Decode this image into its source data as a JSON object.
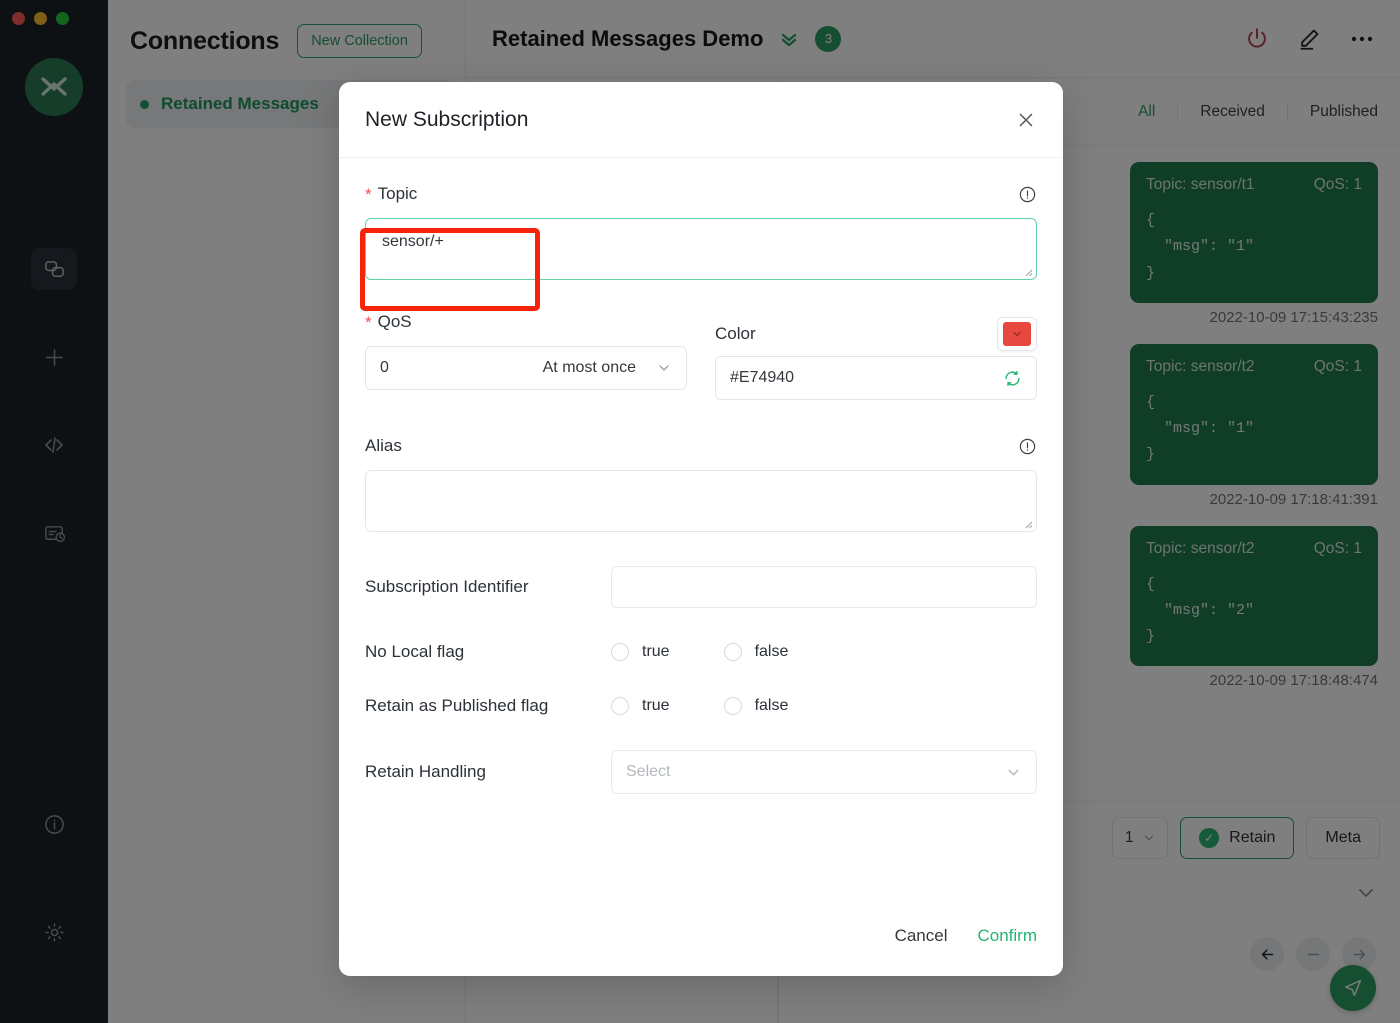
{
  "window": {
    "traffic_lights": [
      "close",
      "minimize",
      "maximize"
    ]
  },
  "rail": {
    "logo_alt": "mqttx-logo",
    "items": [
      {
        "name": "connections",
        "icon": "connections-icon",
        "active": true
      },
      {
        "name": "new-connection",
        "icon": "plus-icon",
        "active": false
      },
      {
        "name": "scripts",
        "icon": "code-icon",
        "active": false
      },
      {
        "name": "log",
        "icon": "log-icon",
        "active": false
      }
    ],
    "bottom_items": [
      {
        "name": "about",
        "icon": "info-icon"
      },
      {
        "name": "settings",
        "icon": "gear-icon"
      }
    ]
  },
  "connections": {
    "title": "Connections",
    "new_collection_label": "New Collection",
    "items": [
      {
        "name": "Retained Messages",
        "status": "connected"
      }
    ]
  },
  "main": {
    "title": "Retained Messages Demo",
    "chevron_icon": "chevron-double-down-icon",
    "badge_count": "3",
    "actions": [
      {
        "name": "disconnect",
        "icon": "power-icon",
        "color": "#b5464a"
      },
      {
        "name": "edit",
        "icon": "pencil-icon",
        "color": "#22272c"
      },
      {
        "name": "more",
        "icon": "ellipsis-icon",
        "color": "#22272c"
      }
    ],
    "message_tabs": [
      {
        "label": "All",
        "active": true
      },
      {
        "label": "Received",
        "active": false
      },
      {
        "label": "Published",
        "active": false
      }
    ],
    "messages": [
      {
        "topic_label": "Topic: sensor/t1",
        "qos_label": "QoS: 1",
        "payload": "{\n  \"msg\": \"1\"\n}",
        "time": "2022-10-09 17:15:43:235"
      },
      {
        "topic_label": "Topic: sensor/t2",
        "qos_label": "QoS: 1",
        "payload": "{\n  \"msg\": \"1\"\n}",
        "time": "2022-10-09 17:18:41:391"
      },
      {
        "topic_label": "Topic: sensor/t2",
        "qos_label": "QoS: 1",
        "payload": "{\n  \"msg\": \"2\"\n}",
        "time": "2022-10-09 17:18:48:474"
      }
    ],
    "composer": {
      "qos_value": "1",
      "retain_label": "Retain",
      "retain_checked": true,
      "meta_label": "Meta",
      "send_icon": "send-icon",
      "collapse_icon": "chevron-down-icon",
      "pager": [
        {
          "name": "prev",
          "icon": "arrow-left-icon",
          "enabled": true
        },
        {
          "name": "stop",
          "icon": "minus-icon",
          "enabled": false
        },
        {
          "name": "next",
          "icon": "arrow-right-icon",
          "enabled": false
        }
      ]
    }
  },
  "modal": {
    "title": "New Subscription",
    "close_icon": "close-icon",
    "topic": {
      "label": "Topic",
      "required": true,
      "required_mark": "*",
      "value": "sensor/+",
      "info_icon": "info-circle-icon"
    },
    "qos": {
      "label": "QoS",
      "required": true,
      "required_mark": "*",
      "value": "0",
      "value_text": "At most once",
      "chevron_icon": "chevron-down-icon"
    },
    "color": {
      "label": "Color",
      "value": "#E74940",
      "swatch_hex": "#E74940",
      "swatch_chevron_icon": "chevron-down-icon",
      "refresh_icon": "refresh-icon"
    },
    "alias": {
      "label": "Alias",
      "value": "",
      "info_icon": "info-circle-icon"
    },
    "subscription_identifier": {
      "label": "Subscription Identifier",
      "value": ""
    },
    "no_local_flag": {
      "label": "No Local flag",
      "options": [
        "true",
        "false"
      ],
      "selected": null
    },
    "retain_as_published_flag": {
      "label": "Retain as Published flag",
      "options": [
        "true",
        "false"
      ],
      "selected": null
    },
    "retain_handling": {
      "label": "Retain Handling",
      "placeholder": "Select",
      "chevron_icon": "chevron-down-icon"
    },
    "cancel_label": "Cancel",
    "confirm_label": "Confirm"
  },
  "annotation": {
    "name": "topic-input-highlight",
    "color": "#F5250B"
  }
}
